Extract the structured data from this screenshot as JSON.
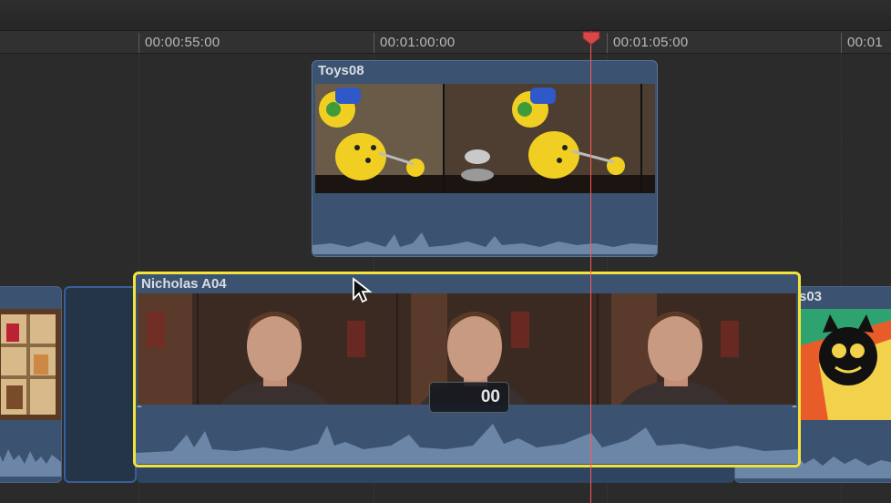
{
  "ruler": {
    "ticks": [
      "00:00:55:00",
      "00:01:00:00",
      "00:01:05:00",
      "00:01"
    ]
  },
  "clips": {
    "connected": {
      "name": "Toys08"
    },
    "primary_selected": {
      "name": "Nicholas A04"
    },
    "primary_right": {
      "name_partial": "s03"
    }
  },
  "timecode_overlay": {
    "value": "00"
  },
  "colors": {
    "selection": "#f2e33a",
    "clip_fill": "#3b5270",
    "playhead": "#ff5a5a"
  },
  "icons": [
    "playhead-marker-icon",
    "mouse-pointer-icon"
  ]
}
